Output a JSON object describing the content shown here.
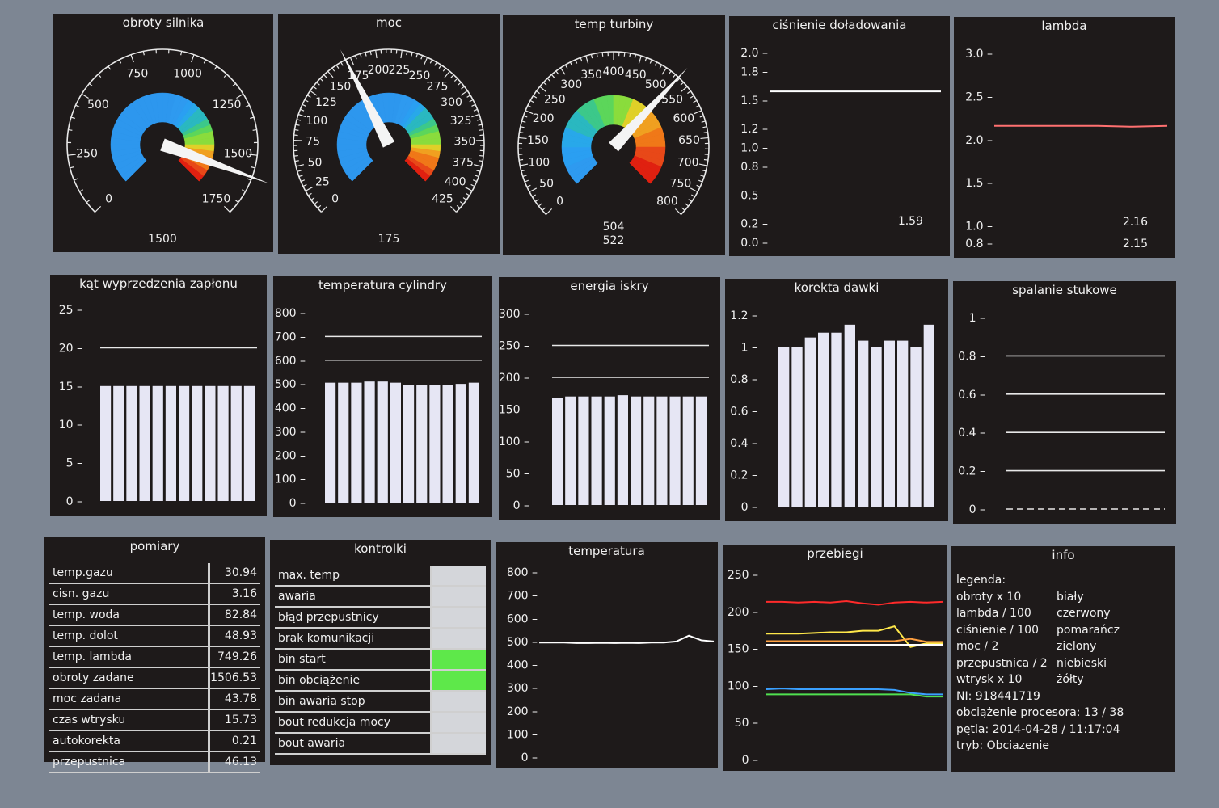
{
  "gauges": [
    {
      "title": "obroty silnika",
      "labels": [
        "0",
        "250",
        "500",
        "750",
        "1000",
        "1250",
        "1500",
        "1750"
      ],
      "bottom_label": "1500",
      "readout": ""
    },
    {
      "title": "moc",
      "labels": [
        "0",
        "25",
        "50",
        "75",
        "100",
        "125",
        "150",
        "175",
        "200",
        "225",
        "250",
        "275",
        "300",
        "325",
        "350",
        "375",
        "400",
        "425"
      ],
      "bottom_label": "175",
      "readout": ""
    },
    {
      "title": "temp turbiny",
      "labels": [
        "0",
        "50",
        "100",
        "150",
        "200",
        "250",
        "300",
        "350",
        "400",
        "450",
        "500",
        "550",
        "600",
        "650",
        "700",
        "750",
        "800"
      ],
      "bottom_label": "522",
      "readout": "504"
    }
  ],
  "line_panels": [
    {
      "title": "ciśnienie doładowania",
      "ticks": [
        "0.0",
        "0.2",
        "0.5",
        "0.8",
        "1.0",
        "1.2",
        "1.5",
        "1.8",
        "2.0"
      ],
      "value_label": "1.59",
      "value_label2": "",
      "line_color": "#ffffff"
    },
    {
      "title": "lambda",
      "ticks": [
        "0.8",
        "1.0",
        "1.5",
        "2.0",
        "2.5",
        "3.0"
      ],
      "value_label": "2.16",
      "value_label2": "2.15",
      "line_color": "#ff7070"
    }
  ],
  "bar_panels": [
    {
      "title": "kąt wyprzedzenia zapłonu",
      "ticks": [
        "0",
        "5",
        "10",
        "15",
        "20",
        "25"
      ]
    },
    {
      "title": "temperatura cylindry",
      "ticks": [
        "0",
        "100",
        "200",
        "300",
        "400",
        "500",
        "600",
        "700",
        "800"
      ]
    },
    {
      "title": "energia iskry",
      "ticks": [
        "0",
        "50",
        "100",
        "150",
        "200",
        "250",
        "300"
      ]
    },
    {
      "title": "korekta dawki",
      "ticks": [
        "0",
        "0.2",
        "0.4",
        "0.6",
        "0.8",
        "1",
        "1.2"
      ]
    },
    {
      "title": "spalanie stukowe",
      "ticks": [
        "0",
        "0.2",
        "0.4",
        "0.6",
        "0.8",
        "1"
      ]
    }
  ],
  "chart_data": [
    {
      "type": "bar",
      "title": "kąt wyprzedzenia zapłonu",
      "ylim": [
        0,
        25
      ],
      "values": [
        15,
        15,
        15,
        15,
        15,
        15,
        15,
        15,
        15,
        15,
        15,
        15
      ],
      "reference_lines": [
        20
      ]
    },
    {
      "type": "bar",
      "title": "temperatura cylindry",
      "ylim": [
        0,
        800
      ],
      "values": [
        505,
        505,
        505,
        510,
        510,
        505,
        495,
        495,
        495,
        495,
        500,
        505
      ],
      "reference_lines": [
        600,
        700
      ]
    },
    {
      "type": "bar",
      "title": "energia iskry",
      "ylim": [
        0,
        300
      ],
      "values": [
        168,
        170,
        170,
        170,
        170,
        172,
        170,
        170,
        170,
        170,
        170,
        170
      ],
      "reference_lines": [
        200,
        250
      ]
    },
    {
      "type": "bar",
      "title": "korekta dawki",
      "ylim": [
        0,
        1.2
      ],
      "values": [
        1.0,
        1.0,
        1.06,
        1.09,
        1.09,
        1.14,
        1.04,
        1.0,
        1.04,
        1.04,
        1.0,
        1.14
      ],
      "reference_lines": []
    },
    {
      "type": "line",
      "title": "spalanie stukowe",
      "ylim": [
        0,
        1
      ],
      "series": [
        {
          "values": [
            0.8,
            0.8
          ]
        },
        {
          "values": [
            0.6,
            0.6
          ]
        },
        {
          "values": [
            0.4,
            0.4
          ]
        },
        {
          "values": [
            0.2,
            0.2
          ]
        },
        {
          "values": [
            0,
            0
          ]
        }
      ]
    },
    {
      "type": "line",
      "title": "ciśnienie doładowania",
      "ylim": [
        0,
        2.0
      ],
      "series": [
        {
          "values": [
            1.59,
            1.59,
            1.59,
            1.59,
            1.59,
            1.59
          ]
        }
      ]
    },
    {
      "type": "line",
      "title": "lambda",
      "ylim": [
        0.8,
        3.0
      ],
      "series": [
        {
          "values": [
            2.16,
            2.16,
            2.16,
            2.16,
            2.15,
            2.16
          ]
        }
      ]
    },
    {
      "type": "line",
      "title": "temperatura",
      "ylim": [
        0,
        800
      ],
      "series": [
        {
          "values": [
            495,
            495,
            495,
            493,
            493,
            494,
            493,
            494,
            493,
            495,
            495,
            500,
            525,
            505,
            500
          ]
        }
      ]
    },
    {
      "type": "line",
      "title": "przebiegi",
      "ylim": [
        0,
        250
      ],
      "series": [
        {
          "color": "#ff2a2a",
          "values": [
            213,
            213,
            212,
            213,
            212,
            214,
            211,
            209,
            212,
            213,
            212,
            213
          ]
        },
        {
          "color": "#ffe84a",
          "values": [
            170,
            170,
            170,
            171,
            172,
            172,
            174,
            174,
            180,
            152,
            157,
            157
          ]
        },
        {
          "color": "#ffa040",
          "values": [
            160,
            160,
            160,
            160,
            160,
            160,
            160,
            160,
            160,
            163,
            159,
            159
          ]
        },
        {
          "color": "#ffffff",
          "values": [
            155,
            155,
            155,
            155,
            155,
            155,
            155,
            155,
            155,
            155,
            155,
            155
          ]
        },
        {
          "color": "#3aa0ff",
          "values": [
            95,
            96,
            95,
            95,
            95,
            95,
            95,
            95,
            94,
            90,
            88,
            88
          ]
        },
        {
          "color": "#50e050",
          "values": [
            88,
            88,
            88,
            88,
            88,
            88,
            88,
            88,
            88,
            88,
            85,
            85
          ]
        }
      ]
    }
  ],
  "bottom_charts": [
    {
      "title": "temperatura",
      "ticks": [
        "0",
        "100",
        "200",
        "300",
        "400",
        "500",
        "600",
        "700",
        "800"
      ]
    },
    {
      "title": "przebiegi",
      "ticks": [
        "0",
        "50",
        "100",
        "150",
        "200",
        "250"
      ]
    }
  ],
  "pomiary": {
    "title": "pomiary",
    "rows": [
      {
        "label": "temp.gazu",
        "value": "30.94"
      },
      {
        "label": "cisn. gazu",
        "value": "3.16"
      },
      {
        "label": "temp. woda",
        "value": "82.84"
      },
      {
        "label": "temp. dolot",
        "value": "48.93"
      },
      {
        "label": "temp. lambda",
        "value": "749.26"
      },
      {
        "label": "obroty zadane",
        "value": "1506.53"
      },
      {
        "label": "moc zadana",
        "value": "43.78"
      },
      {
        "label": "czas wtrysku",
        "value": "15.73"
      },
      {
        "label": "autokorekta",
        "value": "0.21"
      },
      {
        "label": "przepustnica",
        "value": "46.13"
      }
    ]
  },
  "kontrolki": {
    "title": "kontrolki",
    "rows": [
      {
        "label": "max. temp",
        "on": false
      },
      {
        "label": "awaria",
        "on": false
      },
      {
        "label": "błąd przepustnicy",
        "on": false
      },
      {
        "label": "brak komunikacji",
        "on": false
      },
      {
        "label": "bin start",
        "on": true
      },
      {
        "label": "bin obciążenie",
        "on": true
      },
      {
        "label": "bin awaria stop",
        "on": false
      },
      {
        "label": "bout redukcja mocy",
        "on": false
      },
      {
        "label": "bout awaria",
        "on": false
      }
    ],
    "on_color": "#5ee84a",
    "off_color": "#d4d6da"
  },
  "info": {
    "title": "info",
    "legend_label": "legenda:",
    "legend": [
      {
        "name": "obroty x 10",
        "color": "biały"
      },
      {
        "name": "lambda / 100",
        "color": "czerwony"
      },
      {
        "name": "ciśnienie / 100",
        "color": "pomarańcz"
      },
      {
        "name": "moc / 2",
        "color": "zielony"
      },
      {
        "name": "przepustnica / 2",
        "color": "niebieski"
      },
      {
        "name": "wtrysk x 10",
        "color": "żółty"
      }
    ],
    "lines": [
      "NI: 918441719",
      "obciążenie procesora: 13 / 38",
      "pętla: 2014-04-28 / 11:17:04",
      "tryb: Obciazenie"
    ]
  }
}
